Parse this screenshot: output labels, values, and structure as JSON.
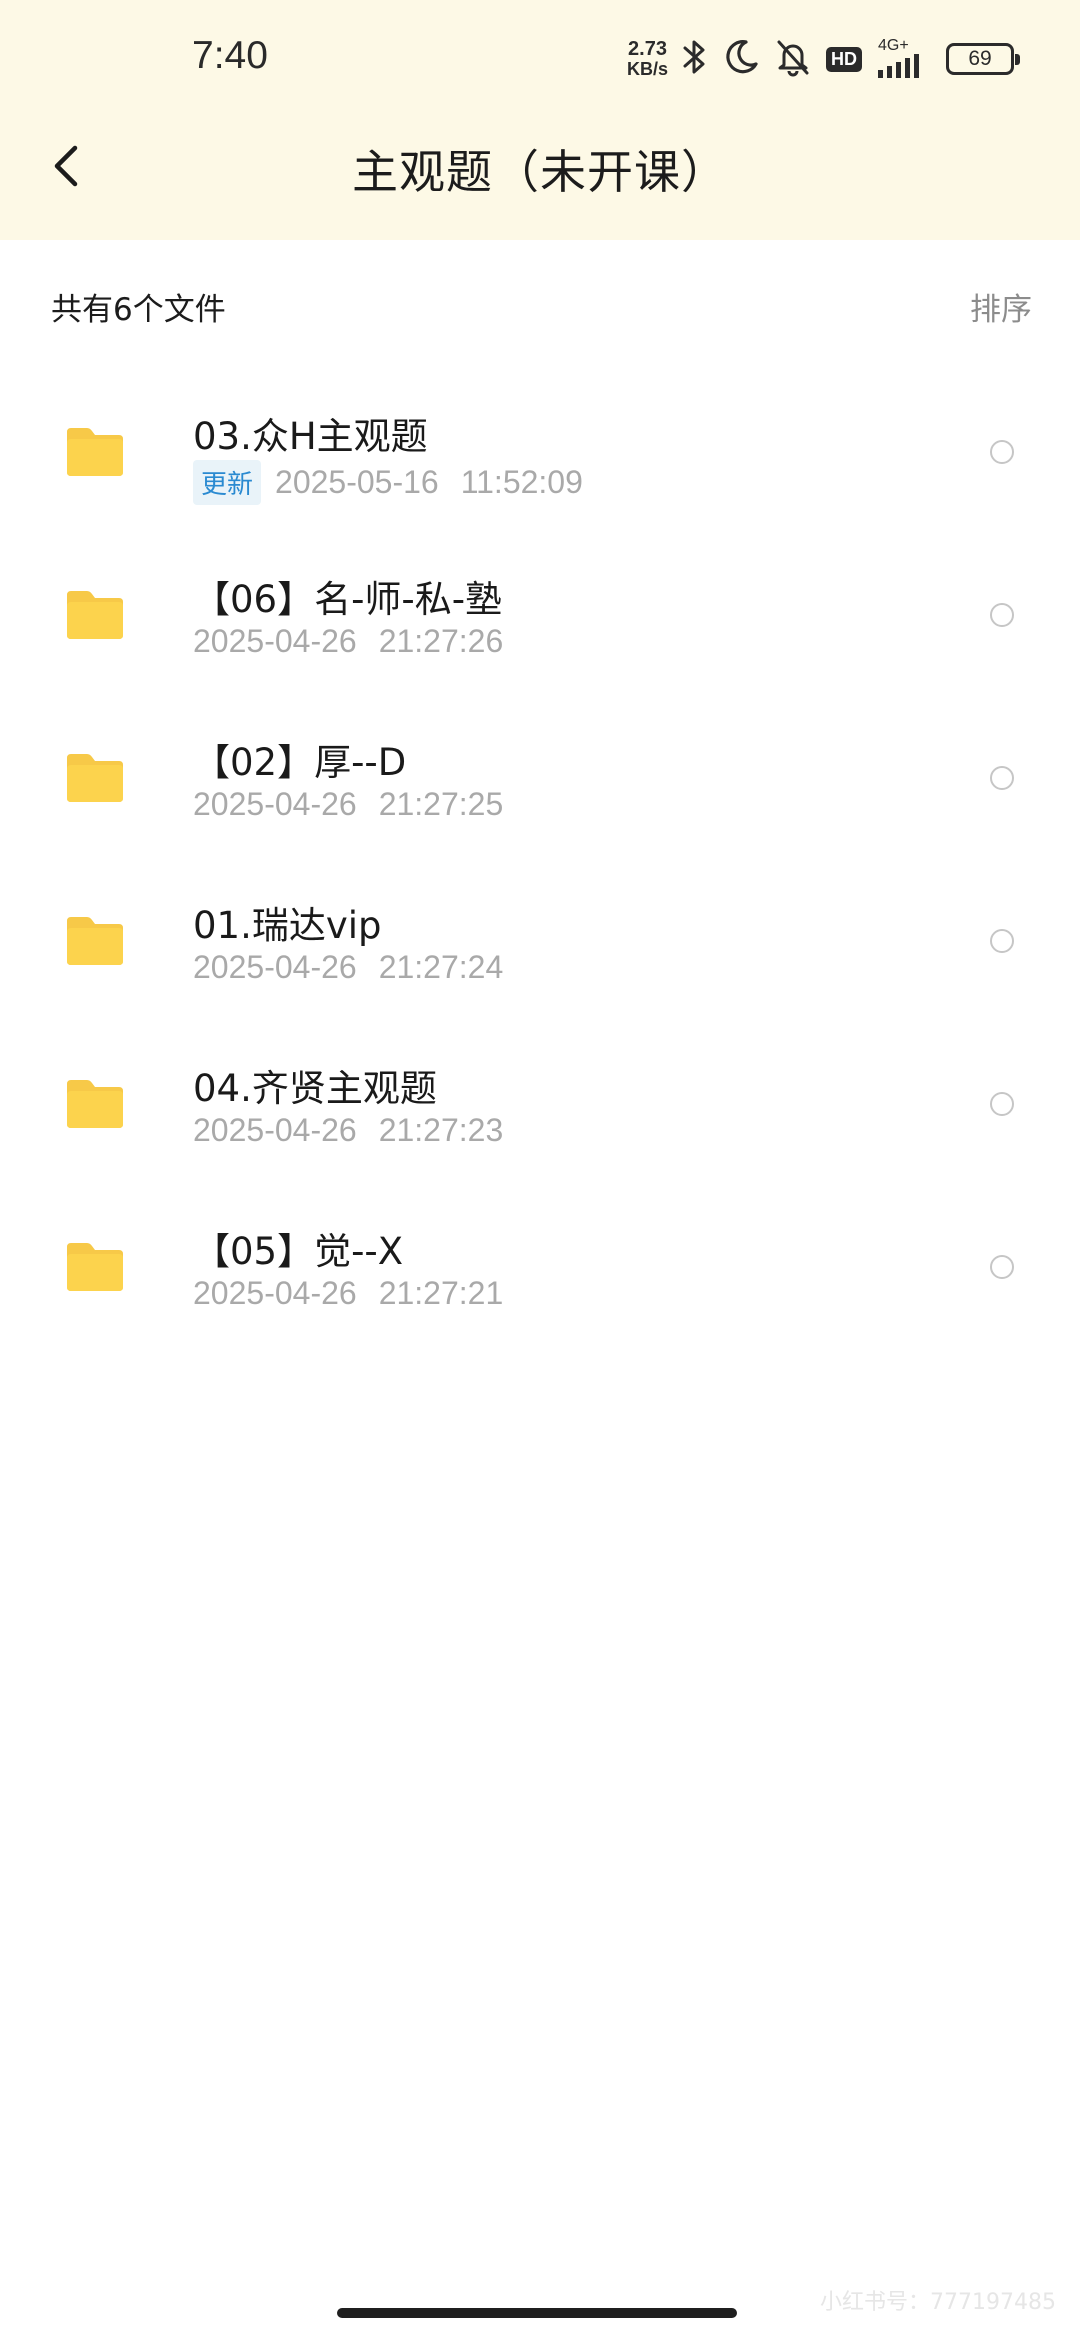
{
  "status_bar": {
    "time": "7:40",
    "net_speed_value": "2.73",
    "net_speed_unit": "KB/s",
    "hd_label": "HD",
    "network_label": "4G+",
    "battery": "69",
    "icons": [
      "bluetooth-icon",
      "moon-icon",
      "bell-off-icon",
      "signal-icon",
      "battery-icon"
    ]
  },
  "header": {
    "title": "主观题（未开课）",
    "back_icon": "chevron-left-icon"
  },
  "summary": {
    "count_text": "共有6个文件",
    "sort_label": "排序"
  },
  "files": [
    {
      "name": "03.众H主观题",
      "badge": "更新",
      "date": "2025-05-16",
      "time": "11:52:09"
    },
    {
      "name": "【06】名-师-私-塾",
      "badge": "",
      "date": "2025-04-26",
      "time": "21:27:26"
    },
    {
      "name": "【02】厚--D",
      "badge": "",
      "date": "2025-04-26",
      "time": "21:27:25"
    },
    {
      "name": "01.瑞达vip",
      "badge": "",
      "date": "2025-04-26",
      "time": "21:27:24"
    },
    {
      "name": "04.齐贤主观题",
      "badge": "",
      "date": "2025-04-26",
      "time": "21:27:23"
    },
    {
      "name": "【05】觉--X",
      "badge": "",
      "date": "2025-04-26",
      "time": "21:27:21"
    }
  ],
  "watermark": "小红书号：777197485",
  "colors": {
    "header_bg": "#fdf9e6",
    "folder": "#fcd34d",
    "badge_text": "#2a8ad1",
    "badge_bg": "#e9f3f9",
    "meta_text": "#a9a9a9"
  }
}
